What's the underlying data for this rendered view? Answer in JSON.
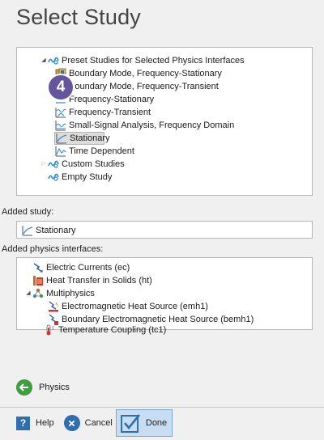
{
  "title": "Select Study",
  "study_tree": {
    "preset_label": "Preset Studies for Selected Physics Interfaces",
    "items": [
      {
        "label": "Boundary Mode, Frequency-Stationary",
        "icon": "boundary-mode-icon"
      },
      {
        "label": "Boundary Mode, Frequency-Transient",
        "icon": "boundary-mode-icon"
      },
      {
        "label": "Frequency-Stationary",
        "icon": "frequency-stationary-icon"
      },
      {
        "label": "Frequency-Transient",
        "icon": "frequency-transient-icon"
      },
      {
        "label": "Small-Signal Analysis, Frequency Domain",
        "icon": "small-signal-icon"
      },
      {
        "label": "Stationary",
        "icon": "stationary-icon",
        "selected": true
      },
      {
        "label": "Time Dependent",
        "icon": "time-dependent-icon"
      }
    ],
    "custom_label": "Custom Studies",
    "empty_label": "Empty Study"
  },
  "step_badge": "4",
  "added_study": {
    "label": "Added study:",
    "value": "Stationary"
  },
  "added_physics": {
    "label": "Added physics interfaces:",
    "items": [
      {
        "label": "Electric Currents (ec)"
      },
      {
        "label": "Heat Transfer in Solids (ht)"
      },
      {
        "label": "Multiphysics"
      },
      {
        "label": "Electromagnetic Heat Source (emh1)"
      },
      {
        "label": "Boundary Electromagnetic Heat Source (bemh1)"
      },
      {
        "label": "Temperature Coupling (tc1)"
      }
    ]
  },
  "nav": {
    "physics_label": "Physics"
  },
  "buttons": {
    "help": "Help",
    "cancel": "Cancel",
    "done": "Done"
  },
  "colors": {
    "badge": "#65559f",
    "accent_blue": "#2f6eb0",
    "green": "#3e9d3e",
    "done_bg": "#c9ddf2"
  }
}
